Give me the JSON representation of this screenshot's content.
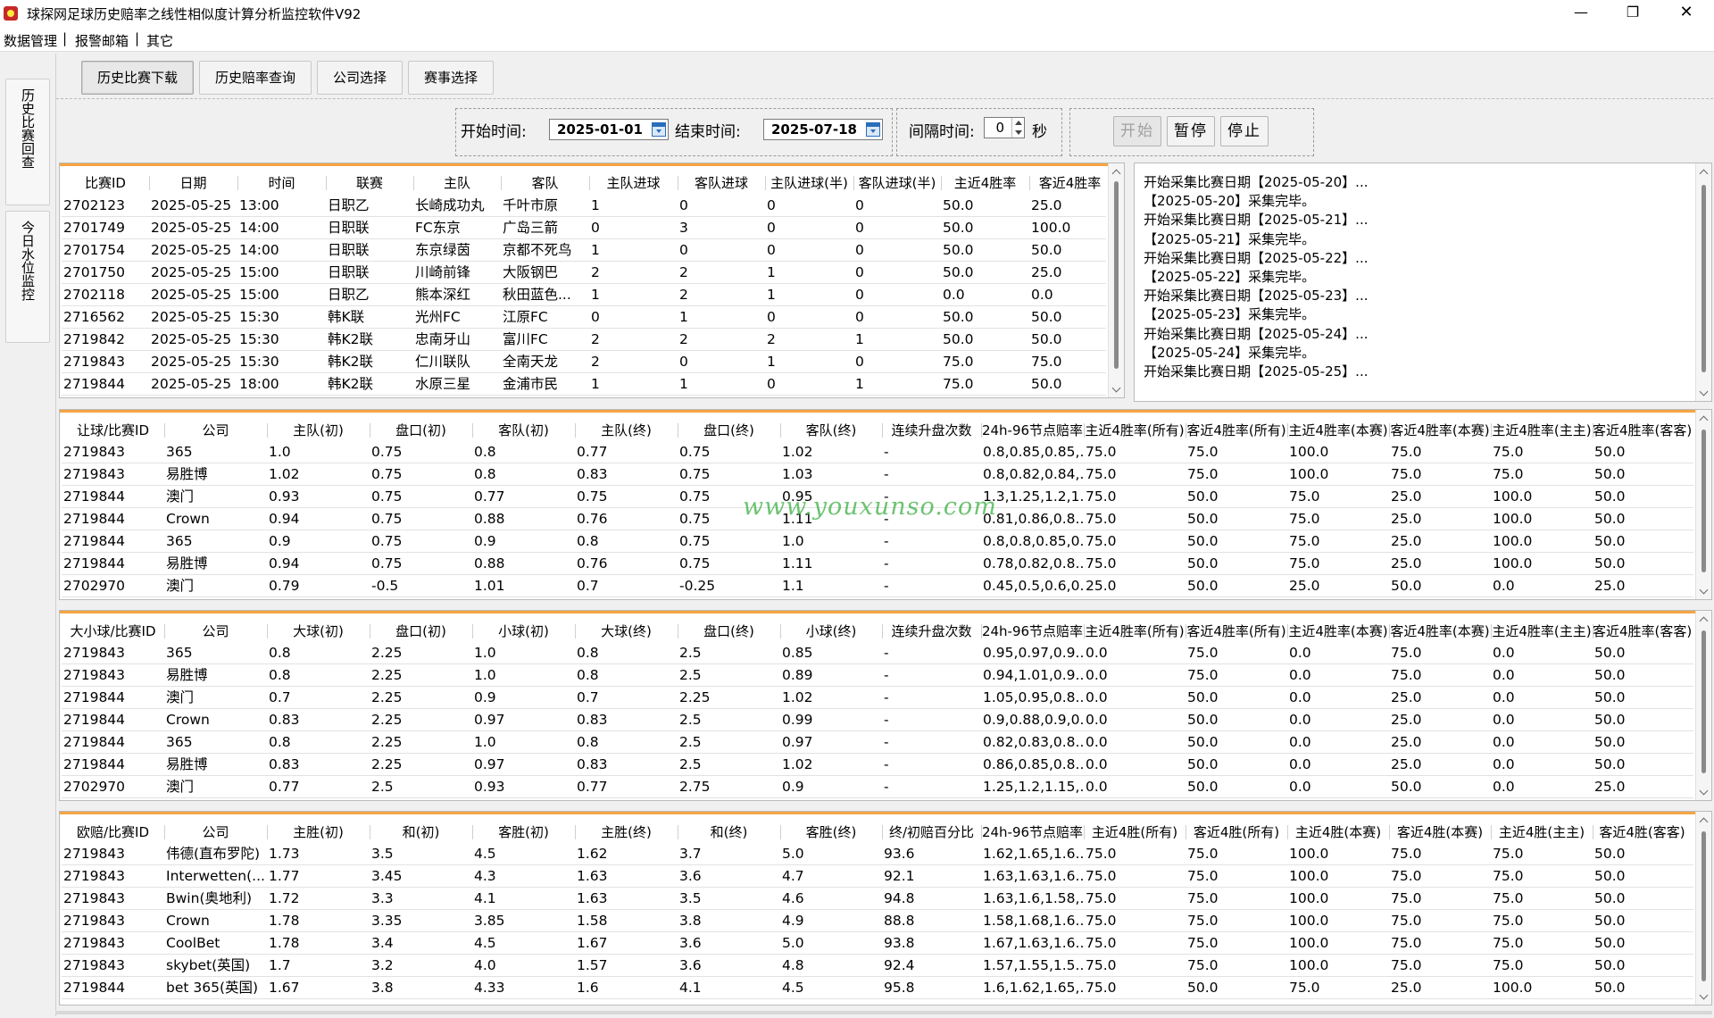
{
  "window": {
    "title": "球探网足球历史赔率之线性相似度计算分析监控软件V92"
  },
  "menu": {
    "items": [
      "数据管理",
      "报警邮箱",
      "其它"
    ],
    "separator": "|"
  },
  "side_tabs": [
    {
      "label": "历史比赛回查"
    },
    {
      "label": "今日水位监控"
    }
  ],
  "top_tabs": [
    "历史比赛下载",
    "历史赔率查询",
    "公司选择",
    "赛事选择"
  ],
  "controls": {
    "start_label": "开始时间:",
    "start_date": "2025-01-01",
    "end_label": "结束时间:",
    "end_date": "2025-07-18",
    "interval_label": "间隔时间:",
    "interval_value": "0",
    "interval_unit": "秒",
    "btn_start": "开始",
    "btn_pause": "暂停",
    "btn_stop": "停止"
  },
  "matches": {
    "headers": [
      "比赛ID",
      "日期",
      "时间",
      "联赛",
      "主队",
      "客队",
      "主队进球",
      "客队进球",
      "主队进球(半)",
      "客队进球(半)",
      "主近4胜率",
      "客近4胜率"
    ],
    "rows": [
      [
        "2702123",
        "2025-05-25",
        "13:00",
        "日职乙",
        "长崎成功丸",
        "千叶市原",
        "1",
        "0",
        "0",
        "0",
        "50.0",
        "25.0"
      ],
      [
        "2701749",
        "2025-05-25",
        "14:00",
        "日职联",
        "FC东京",
        "广岛三箭",
        "0",
        "3",
        "0",
        "0",
        "50.0",
        "100.0"
      ],
      [
        "2701754",
        "2025-05-25",
        "14:00",
        "日职联",
        "东京绿茵",
        "京都不死鸟",
        "1",
        "0",
        "0",
        "0",
        "50.0",
        "50.0"
      ],
      [
        "2701750",
        "2025-05-25",
        "15:00",
        "日职联",
        "川崎前锋",
        "大阪钢巴",
        "2",
        "2",
        "1",
        "0",
        "50.0",
        "25.0"
      ],
      [
        "2702118",
        "2025-05-25",
        "15:00",
        "日职乙",
        "熊本深红",
        "秋田蓝色...",
        "1",
        "2",
        "1",
        "0",
        "0.0",
        "0.0"
      ],
      [
        "2716562",
        "2025-05-25",
        "15:30",
        "韩K联",
        "光州FC",
        "江原FC",
        "0",
        "1",
        "0",
        "0",
        "50.0",
        "50.0"
      ],
      [
        "2719842",
        "2025-05-25",
        "15:30",
        "韩K2联",
        "忠南牙山",
        "富川FC",
        "2",
        "2",
        "2",
        "1",
        "50.0",
        "50.0"
      ],
      [
        "2719843",
        "2025-05-25",
        "15:30",
        "韩K2联",
        "仁川联队",
        "全南天龙",
        "2",
        "0",
        "1",
        "0",
        "75.0",
        "75.0"
      ],
      [
        "2719844",
        "2025-05-25",
        "18:00",
        "韩K2联",
        "水原三星",
        "金浦市民",
        "1",
        "1",
        "0",
        "1",
        "75.0",
        "50.0"
      ]
    ]
  },
  "log": [
    "开始采集比赛日期【2025-05-20】...",
    "【2025-05-20】采集完毕。",
    "开始采集比赛日期【2025-05-21】...",
    "【2025-05-21】采集完毕。",
    "开始采集比赛日期【2025-05-22】...",
    "【2025-05-22】采集完毕。",
    "开始采集比赛日期【2025-05-23】...",
    "【2025-05-23】采集完毕。",
    "开始采集比赛日期【2025-05-24】...",
    "【2025-05-24】采集完毕。",
    "开始采集比赛日期【2025-05-25】..."
  ],
  "handicap": {
    "headers": [
      "让球/比赛ID",
      "公司",
      "主队(初)",
      "盘口(初)",
      "客队(初)",
      "主队(终)",
      "盘口(终)",
      "客队(终)",
      "连续升盘次数",
      "24h-96节点赔率",
      "主近4胜率(所有)",
      "客近4胜率(所有)",
      "主近4胜率(本赛)",
      "客近4胜率(本赛)",
      "主近4胜率(主主)",
      "客近4胜率(客客)"
    ],
    "rows": [
      [
        "2719843",
        "365",
        "1.0",
        "0.75",
        "0.8",
        "0.77",
        "0.75",
        "1.02",
        "-",
        "0.8,0.85,0.85,...",
        "75.0",
        "75.0",
        "100.0",
        "75.0",
        "75.0",
        "50.0"
      ],
      [
        "2719843",
        "易胜博",
        "1.02",
        "0.75",
        "0.8",
        "0.83",
        "0.75",
        "1.03",
        "-",
        "0.8,0.82,0.84,...",
        "75.0",
        "75.0",
        "100.0",
        "75.0",
        "75.0",
        "50.0"
      ],
      [
        "2719844",
        "澳门",
        "0.93",
        "0.75",
        "0.77",
        "0.75",
        "0.75",
        "0.95",
        "-",
        "1.3,1.25,1.2,1...",
        "75.0",
        "50.0",
        "75.0",
        "25.0",
        "100.0",
        "50.0"
      ],
      [
        "2719844",
        "Crown",
        "0.94",
        "0.75",
        "0.88",
        "0.76",
        "0.75",
        "1.11",
        "-",
        "0.81,0.86,0.8...",
        "75.0",
        "50.0",
        "75.0",
        "25.0",
        "100.0",
        "50.0"
      ],
      [
        "2719844",
        "365",
        "0.9",
        "0.75",
        "0.9",
        "0.8",
        "0.75",
        "1.0",
        "-",
        "0.8,0.8,0.85,0...",
        "75.0",
        "50.0",
        "75.0",
        "25.0",
        "100.0",
        "50.0"
      ],
      [
        "2719844",
        "易胜博",
        "0.94",
        "0.75",
        "0.88",
        "0.76",
        "0.75",
        "1.11",
        "-",
        "0.78,0.82,0.8...",
        "75.0",
        "50.0",
        "75.0",
        "25.0",
        "100.0",
        "50.0"
      ],
      [
        "2702970",
        "澳门",
        "0.79",
        "-0.5",
        "1.01",
        "0.7",
        "-0.25",
        "1.1",
        "-",
        "0.45,0.5,0.6,0...",
        "25.0",
        "50.0",
        "25.0",
        "50.0",
        "0.0",
        "25.0"
      ]
    ]
  },
  "totals": {
    "headers": [
      "大小球/比赛ID",
      "公司",
      "大球(初)",
      "盘口(初)",
      "小球(初)",
      "大球(终)",
      "盘口(终)",
      "小球(终)",
      "连续升盘次数",
      "24h-96节点赔率",
      "主近4胜率(所有)",
      "客近4胜率(所有)",
      "主近4胜率(本赛)",
      "客近4胜率(本赛)",
      "主近4胜率(主主)",
      "客近4胜率(客客)"
    ],
    "rows": [
      [
        "2719843",
        "365",
        "0.8",
        "2.25",
        "1.0",
        "0.8",
        "2.5",
        "0.85",
        "-",
        "0.95,0.97,0.9...",
        "0.0",
        "75.0",
        "0.0",
        "75.0",
        "0.0",
        "50.0"
      ],
      [
        "2719843",
        "易胜博",
        "0.8",
        "2.25",
        "1.0",
        "0.8",
        "2.5",
        "0.89",
        "-",
        "0.94,1.01,0.9...",
        "0.0",
        "75.0",
        "0.0",
        "75.0",
        "0.0",
        "50.0"
      ],
      [
        "2719844",
        "澳门",
        "0.7",
        "2.25",
        "0.9",
        "0.7",
        "2.25",
        "1.02",
        "-",
        "1.05,0.95,0.8...",
        "0.0",
        "50.0",
        "0.0",
        "25.0",
        "0.0",
        "50.0"
      ],
      [
        "2719844",
        "Crown",
        "0.83",
        "2.25",
        "0.97",
        "0.83",
        "2.5",
        "0.99",
        "-",
        "0.9,0.88,0.9,0...",
        "0.0",
        "50.0",
        "0.0",
        "25.0",
        "0.0",
        "50.0"
      ],
      [
        "2719844",
        "365",
        "0.8",
        "2.25",
        "1.0",
        "0.8",
        "2.5",
        "0.97",
        "-",
        "0.82,0.83,0.8...",
        "0.0",
        "50.0",
        "0.0",
        "25.0",
        "0.0",
        "50.0"
      ],
      [
        "2719844",
        "易胜博",
        "0.83",
        "2.25",
        "0.97",
        "0.83",
        "2.5",
        "1.02",
        "-",
        "0.86,0.85,0.8...",
        "0.0",
        "50.0",
        "0.0",
        "25.0",
        "0.0",
        "50.0"
      ],
      [
        "2702970",
        "澳门",
        "0.77",
        "2.5",
        "0.93",
        "0.77",
        "2.75",
        "0.9",
        "-",
        "1.25,1.2,1.15,...",
        "0.0",
        "50.0",
        "0.0",
        "50.0",
        "0.0",
        "25.0"
      ]
    ]
  },
  "euro": {
    "headers": [
      "欧赔/比赛ID",
      "公司",
      "主胜(初)",
      "和(初)",
      "客胜(初)",
      "主胜(终)",
      "和(终)",
      "客胜(终)",
      "终/初赔百分比",
      "24h-96节点赔率",
      "主近4胜(所有)",
      "客近4胜(所有)",
      "主近4胜(本赛)",
      "客近4胜(本赛)",
      "主近4胜(主主)",
      "客近4胜(客客)"
    ],
    "rows": [
      [
        "2719843",
        "伟德(直布罗陀)",
        "1.73",
        "3.5",
        "4.5",
        "1.62",
        "3.7",
        "5.0",
        "93.6",
        "1.62,1.65,1.6...",
        "75.0",
        "75.0",
        "100.0",
        "75.0",
        "75.0",
        "50.0"
      ],
      [
        "2719843",
        "Interwetten(...",
        "1.77",
        "3.45",
        "4.3",
        "1.63",
        "3.6",
        "4.7",
        "92.1",
        "1.63,1.63,1.6...",
        "75.0",
        "75.0",
        "100.0",
        "75.0",
        "75.0",
        "50.0"
      ],
      [
        "2719843",
        "Bwin(奥地利)",
        "1.72",
        "3.3",
        "4.1",
        "1.63",
        "3.5",
        "4.6",
        "94.8",
        "1.63,1.6,1.58,...",
        "75.0",
        "75.0",
        "100.0",
        "75.0",
        "75.0",
        "50.0"
      ],
      [
        "2719843",
        "Crown",
        "1.78",
        "3.35",
        "3.85",
        "1.58",
        "3.8",
        "4.9",
        "88.8",
        "1.58,1.68,1.6...",
        "75.0",
        "75.0",
        "100.0",
        "75.0",
        "75.0",
        "50.0"
      ],
      [
        "2719843",
        "CoolBet",
        "1.78",
        "3.4",
        "4.5",
        "1.67",
        "3.6",
        "5.0",
        "93.8",
        "1.67,1.63,1.6...",
        "75.0",
        "75.0",
        "100.0",
        "75.0",
        "75.0",
        "50.0"
      ],
      [
        "2719843",
        "skybet(英国)",
        "1.7",
        "3.2",
        "4.0",
        "1.57",
        "3.6",
        "4.8",
        "92.4",
        "1.57,1.55,1.5...",
        "75.0",
        "75.0",
        "100.0",
        "75.0",
        "75.0",
        "50.0"
      ],
      [
        "2719844",
        "bet 365(英国)",
        "1.67",
        "3.8",
        "4.33",
        "1.6",
        "4.1",
        "4.5",
        "95.8",
        "1.6,1.62,1.65,...",
        "75.0",
        "50.0",
        "75.0",
        "25.0",
        "100.0",
        "50.0"
      ]
    ]
  },
  "watermark": "www.youxunso.com"
}
